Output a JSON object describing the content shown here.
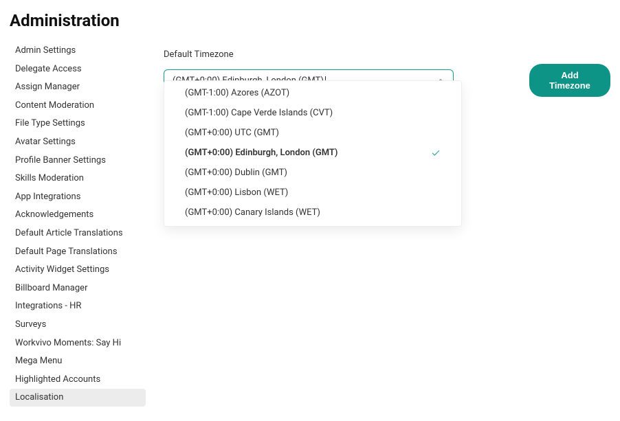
{
  "page": {
    "title": "Administration"
  },
  "sidebar": {
    "items": [
      {
        "label": "Admin Settings"
      },
      {
        "label": "Delegate Access"
      },
      {
        "label": "Assign Manager"
      },
      {
        "label": "Content Moderation"
      },
      {
        "label": "File Type Settings"
      },
      {
        "label": "Avatar Settings"
      },
      {
        "label": "Profile Banner Settings"
      },
      {
        "label": "Skills Moderation"
      },
      {
        "label": "App Integrations"
      },
      {
        "label": "Acknowledgements"
      },
      {
        "label": "Default Article Translations"
      },
      {
        "label": "Default Page Translations"
      },
      {
        "label": "Activity Widget Settings"
      },
      {
        "label": "Billboard Manager"
      },
      {
        "label": "Integrations - HR"
      },
      {
        "label": "Surveys"
      },
      {
        "label": "Workvivo Moments: Say Hi"
      },
      {
        "label": "Mega Menu"
      },
      {
        "label": "Highlighted Accounts"
      },
      {
        "label": "Localisation"
      }
    ],
    "activeIndex": 19
  },
  "main": {
    "timezone_label": "Default Timezone",
    "timezone_value": "(GMT+0:00) Edinburgh, London (GMT)",
    "add_timezone_label": "Add Timezone",
    "options": [
      {
        "label": "(GMT-1:00) Azores (AZOT)"
      },
      {
        "label": "(GMT-1:00) Cape Verde Islands (CVT)"
      },
      {
        "label": "(GMT+0:00) UTC (GMT)"
      },
      {
        "label": "(GMT+0:00) Edinburgh, London (GMT)",
        "selected": true
      },
      {
        "label": "(GMT+0:00) Dublin (GMT)"
      },
      {
        "label": "(GMT+0:00) Lisbon (WET)"
      },
      {
        "label": "(GMT+0:00) Canary Islands (WET)"
      }
    ]
  },
  "colors": {
    "accent": "#0e9486"
  }
}
